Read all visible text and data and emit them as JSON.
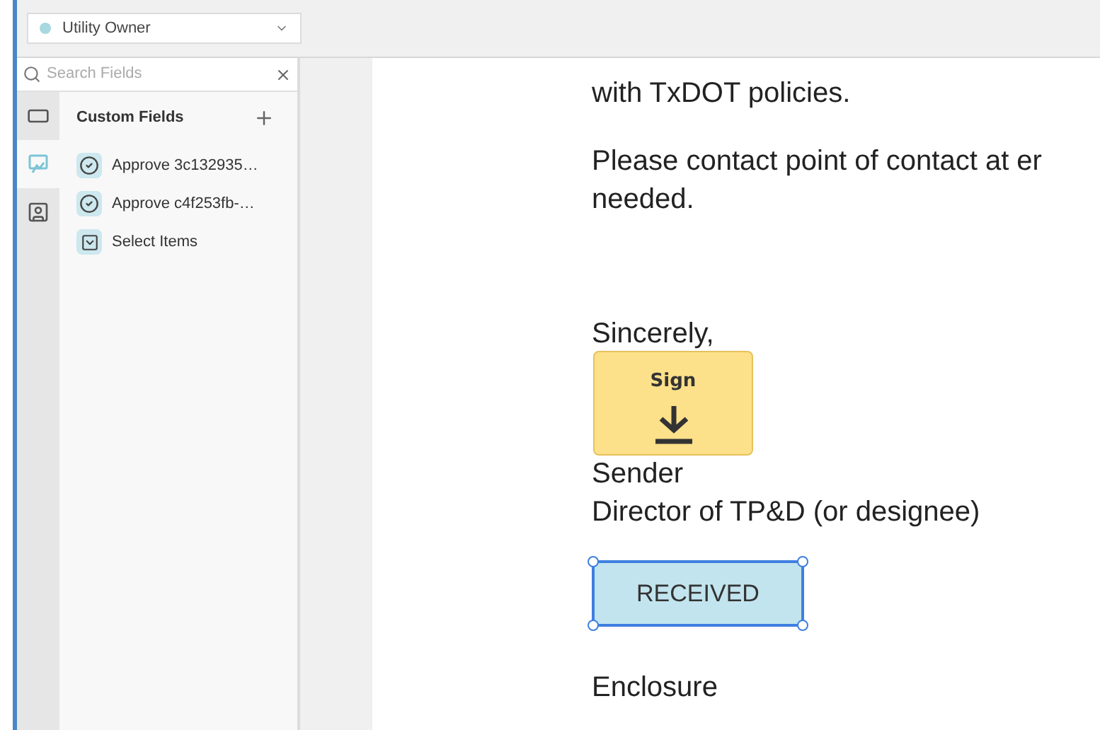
{
  "role_select": {
    "value": "Utility Owner",
    "color": "#a8d8e0"
  },
  "search": {
    "placeholder": "Search Fields"
  },
  "rail_tabs": [
    {
      "kind": "rectangle",
      "selected": false
    },
    {
      "kind": "signature",
      "selected": true
    },
    {
      "kind": "user",
      "selected": false
    }
  ],
  "panel": {
    "title": "Custom Fields",
    "items": [
      {
        "kind": "checkbox",
        "label": "Approve 3c132935…"
      },
      {
        "kind": "checkbox",
        "label": "Approve c4f253fb-…"
      },
      {
        "kind": "select",
        "label": "Select Items"
      }
    ]
  },
  "document": {
    "paragraphs": [
      [
        "with TxDOT policies."
      ],
      [
        "Please contact point of contact at er",
        "needed."
      ]
    ],
    "closing": "Sincerely,",
    "sign_label": "Sign",
    "signer": [
      "Sender",
      "Director of TP&D (or designee)"
    ],
    "stamp": {
      "label": "RECEIVED",
      "selected": true
    },
    "enclosure": "Enclosure"
  }
}
